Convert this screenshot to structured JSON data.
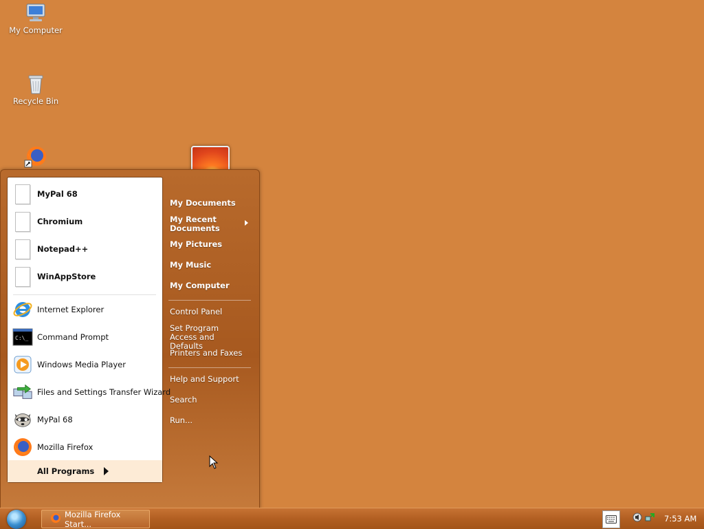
{
  "desktop": {
    "icons": [
      {
        "label": "My Computer",
        "icon": "computer-icon"
      },
      {
        "label": "Recycle Bin",
        "icon": "recycle-bin-icon"
      },
      {
        "label": "",
        "icon": "firefox-shortcut-icon"
      }
    ]
  },
  "start_menu": {
    "pinned": [
      {
        "label": "MyPal 68",
        "icon": "blank-document-icon"
      },
      {
        "label": "Chromium",
        "icon": "blank-document-icon"
      },
      {
        "label": "Notepad++",
        "icon": "blank-document-icon"
      },
      {
        "label": "WinAppStore",
        "icon": "blank-document-icon"
      }
    ],
    "recent": [
      {
        "label": "Internet Explorer",
        "icon": "internet-explorer-icon"
      },
      {
        "label": "Command Prompt",
        "icon": "command-prompt-icon"
      },
      {
        "label": "Windows Media Player",
        "icon": "media-player-icon"
      },
      {
        "label": "Files and Settings Transfer Wizard",
        "icon": "transfer-wizard-icon"
      },
      {
        "label": "MyPal 68",
        "icon": "mypal-raccoon-icon"
      },
      {
        "label": "Mozilla Firefox",
        "icon": "firefox-icon"
      }
    ],
    "all_programs": "All Programs",
    "places": [
      {
        "label": "My Documents"
      },
      {
        "label": "My Recent Documents"
      },
      {
        "label": "My Pictures"
      },
      {
        "label": "My Music"
      },
      {
        "label": "My Computer"
      }
    ],
    "settings": [
      {
        "label": "Control Panel"
      },
      {
        "label": "Set Program Access and Defaults"
      },
      {
        "label": "Printers and Faxes"
      }
    ],
    "help": [
      {
        "label": "Help and Support"
      },
      {
        "label": "Search"
      },
      {
        "label": "Run..."
      }
    ]
  },
  "taskbar": {
    "window_button": "Mozilla Firefox Start...",
    "clock": "7:53 AM"
  },
  "colors": {
    "desktop": "#d4843e",
    "menu_accent": "#a7591f",
    "all_programs_bg": "#fdebd6"
  }
}
